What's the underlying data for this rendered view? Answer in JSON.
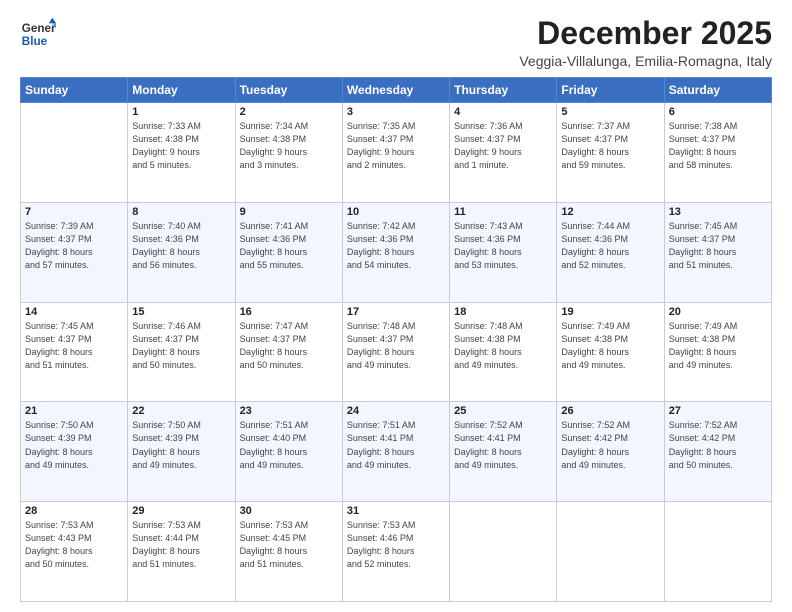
{
  "header": {
    "logo_line1": "General",
    "logo_line2": "Blue",
    "month_year": "December 2025",
    "location": "Veggia-Villalunga, Emilia-Romagna, Italy"
  },
  "days_of_week": [
    "Sunday",
    "Monday",
    "Tuesday",
    "Wednesday",
    "Thursday",
    "Friday",
    "Saturday"
  ],
  "weeks": [
    [
      {
        "day": "",
        "info": ""
      },
      {
        "day": "1",
        "info": "Sunrise: 7:33 AM\nSunset: 4:38 PM\nDaylight: 9 hours\nand 5 minutes."
      },
      {
        "day": "2",
        "info": "Sunrise: 7:34 AM\nSunset: 4:38 PM\nDaylight: 9 hours\nand 3 minutes."
      },
      {
        "day": "3",
        "info": "Sunrise: 7:35 AM\nSunset: 4:37 PM\nDaylight: 9 hours\nand 2 minutes."
      },
      {
        "day": "4",
        "info": "Sunrise: 7:36 AM\nSunset: 4:37 PM\nDaylight: 9 hours\nand 1 minute."
      },
      {
        "day": "5",
        "info": "Sunrise: 7:37 AM\nSunset: 4:37 PM\nDaylight: 8 hours\nand 59 minutes."
      },
      {
        "day": "6",
        "info": "Sunrise: 7:38 AM\nSunset: 4:37 PM\nDaylight: 8 hours\nand 58 minutes."
      }
    ],
    [
      {
        "day": "7",
        "info": "Sunrise: 7:39 AM\nSunset: 4:37 PM\nDaylight: 8 hours\nand 57 minutes."
      },
      {
        "day": "8",
        "info": "Sunrise: 7:40 AM\nSunset: 4:36 PM\nDaylight: 8 hours\nand 56 minutes."
      },
      {
        "day": "9",
        "info": "Sunrise: 7:41 AM\nSunset: 4:36 PM\nDaylight: 8 hours\nand 55 minutes."
      },
      {
        "day": "10",
        "info": "Sunrise: 7:42 AM\nSunset: 4:36 PM\nDaylight: 8 hours\nand 54 minutes."
      },
      {
        "day": "11",
        "info": "Sunrise: 7:43 AM\nSunset: 4:36 PM\nDaylight: 8 hours\nand 53 minutes."
      },
      {
        "day": "12",
        "info": "Sunrise: 7:44 AM\nSunset: 4:36 PM\nDaylight: 8 hours\nand 52 minutes."
      },
      {
        "day": "13",
        "info": "Sunrise: 7:45 AM\nSunset: 4:37 PM\nDaylight: 8 hours\nand 51 minutes."
      }
    ],
    [
      {
        "day": "14",
        "info": "Sunrise: 7:45 AM\nSunset: 4:37 PM\nDaylight: 8 hours\nand 51 minutes."
      },
      {
        "day": "15",
        "info": "Sunrise: 7:46 AM\nSunset: 4:37 PM\nDaylight: 8 hours\nand 50 minutes."
      },
      {
        "day": "16",
        "info": "Sunrise: 7:47 AM\nSunset: 4:37 PM\nDaylight: 8 hours\nand 50 minutes."
      },
      {
        "day": "17",
        "info": "Sunrise: 7:48 AM\nSunset: 4:37 PM\nDaylight: 8 hours\nand 49 minutes."
      },
      {
        "day": "18",
        "info": "Sunrise: 7:48 AM\nSunset: 4:38 PM\nDaylight: 8 hours\nand 49 minutes."
      },
      {
        "day": "19",
        "info": "Sunrise: 7:49 AM\nSunset: 4:38 PM\nDaylight: 8 hours\nand 49 minutes."
      },
      {
        "day": "20",
        "info": "Sunrise: 7:49 AM\nSunset: 4:38 PM\nDaylight: 8 hours\nand 49 minutes."
      }
    ],
    [
      {
        "day": "21",
        "info": "Sunrise: 7:50 AM\nSunset: 4:39 PM\nDaylight: 8 hours\nand 49 minutes."
      },
      {
        "day": "22",
        "info": "Sunrise: 7:50 AM\nSunset: 4:39 PM\nDaylight: 8 hours\nand 49 minutes."
      },
      {
        "day": "23",
        "info": "Sunrise: 7:51 AM\nSunset: 4:40 PM\nDaylight: 8 hours\nand 49 minutes."
      },
      {
        "day": "24",
        "info": "Sunrise: 7:51 AM\nSunset: 4:41 PM\nDaylight: 8 hours\nand 49 minutes."
      },
      {
        "day": "25",
        "info": "Sunrise: 7:52 AM\nSunset: 4:41 PM\nDaylight: 8 hours\nand 49 minutes."
      },
      {
        "day": "26",
        "info": "Sunrise: 7:52 AM\nSunset: 4:42 PM\nDaylight: 8 hours\nand 49 minutes."
      },
      {
        "day": "27",
        "info": "Sunrise: 7:52 AM\nSunset: 4:42 PM\nDaylight: 8 hours\nand 50 minutes."
      }
    ],
    [
      {
        "day": "28",
        "info": "Sunrise: 7:53 AM\nSunset: 4:43 PM\nDaylight: 8 hours\nand 50 minutes."
      },
      {
        "day": "29",
        "info": "Sunrise: 7:53 AM\nSunset: 4:44 PM\nDaylight: 8 hours\nand 51 minutes."
      },
      {
        "day": "30",
        "info": "Sunrise: 7:53 AM\nSunset: 4:45 PM\nDaylight: 8 hours\nand 51 minutes."
      },
      {
        "day": "31",
        "info": "Sunrise: 7:53 AM\nSunset: 4:46 PM\nDaylight: 8 hours\nand 52 minutes."
      },
      {
        "day": "",
        "info": ""
      },
      {
        "day": "",
        "info": ""
      },
      {
        "day": "",
        "info": ""
      }
    ]
  ]
}
